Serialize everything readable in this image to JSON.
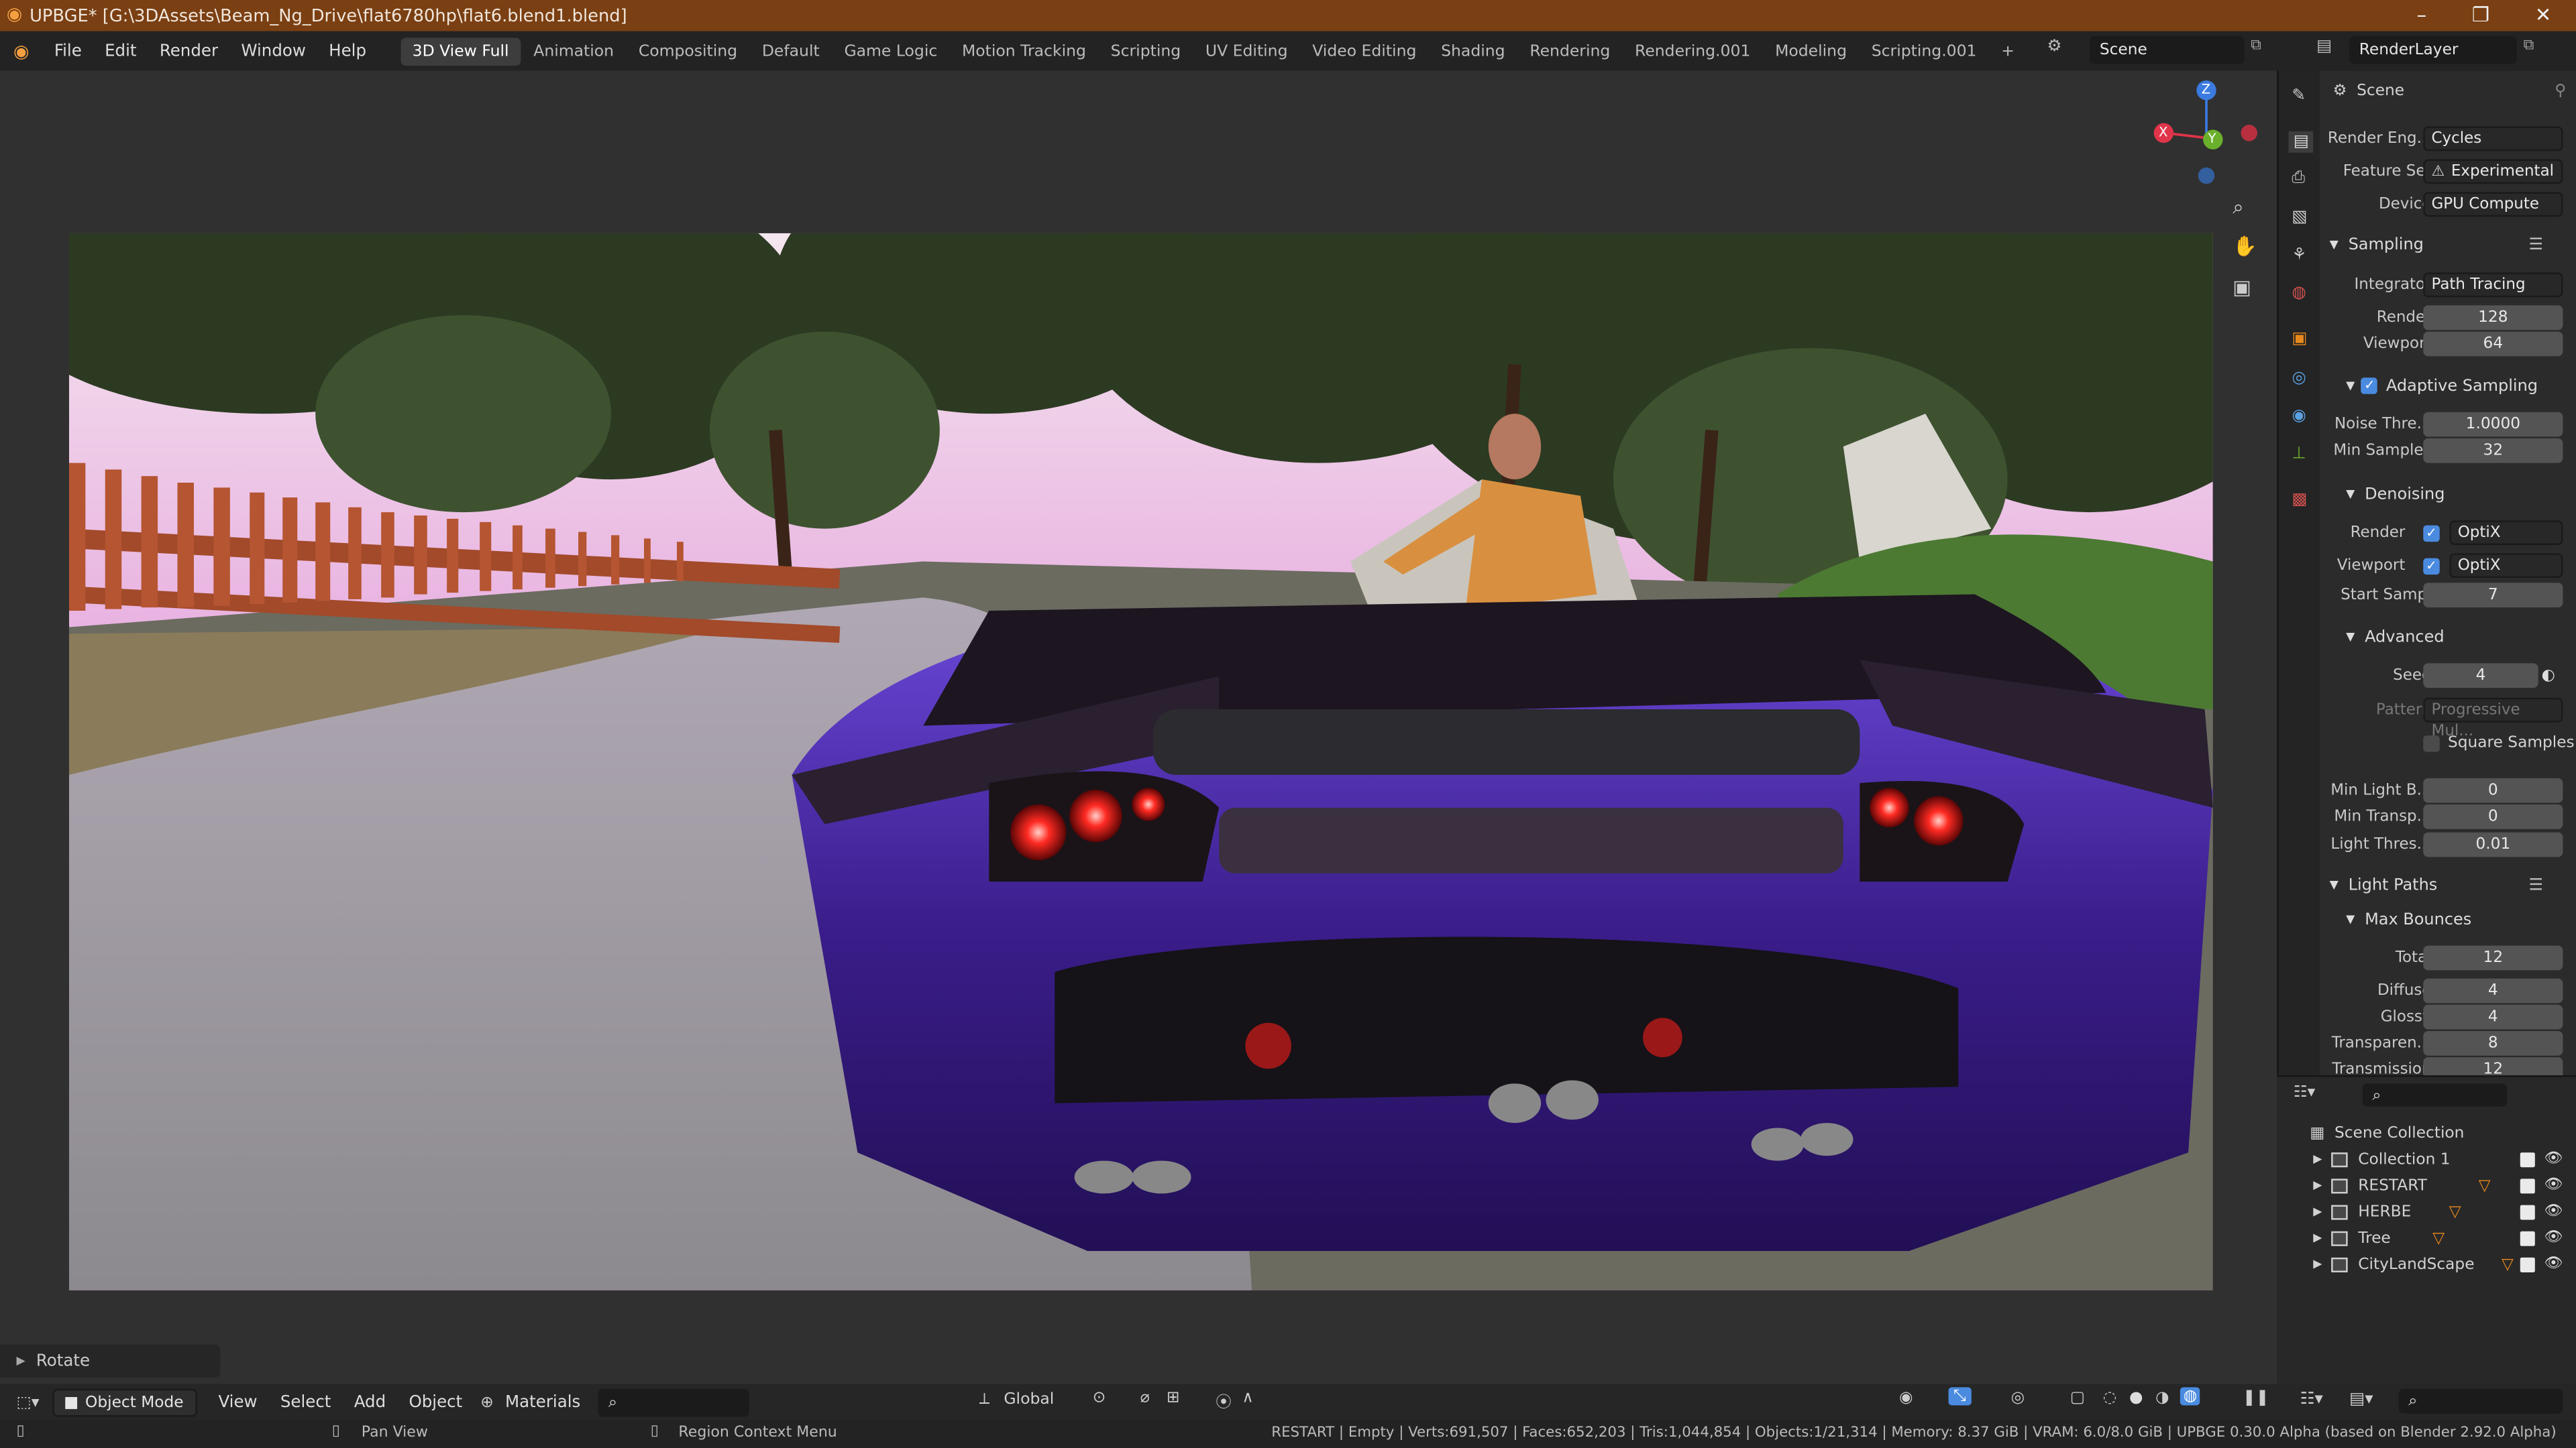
{
  "window": {
    "title": "UPBGE* [G:\\3DAssets\\Beam_Ng_Drive\\flat6780hp\\flat6.blend1.blend]",
    "minimize": "–",
    "maximize": "❐",
    "close": "✕"
  },
  "menu": [
    "File",
    "Edit",
    "Render",
    "Window",
    "Help"
  ],
  "workspaces": [
    "3D View Full",
    "Animation",
    "Compositing",
    "Default",
    "Game Logic",
    "Motion Tracking",
    "Scripting",
    "UV Editing",
    "Video Editing",
    "Shading",
    "Rendering",
    "Rendering.001",
    "Modeling",
    "Scripting.001"
  ],
  "workspace_add": "+",
  "scene": {
    "name": "Scene",
    "render_layer": "RenderLayer"
  },
  "viewport": {
    "gizmo": {
      "x": "X",
      "y": "Y",
      "z": "Z"
    },
    "last_operator": "Rotate"
  },
  "header": {
    "mode": "Object Mode",
    "menus": [
      "View",
      "Select",
      "Add",
      "Object"
    ],
    "materials": "Materials",
    "orientation": "Global"
  },
  "properties": {
    "title": "Scene",
    "render_engine_label": "Render Eng...",
    "render_engine": "Cycles",
    "feature_set_label": "Feature Set",
    "feature_set": "Experimental",
    "device_label": "Device",
    "device": "GPU Compute",
    "sampling": "Sampling",
    "integrator_label": "Integrator",
    "integrator": "Path Tracing",
    "render_label": "Render",
    "render_samples": "128",
    "viewport_label": "Viewport",
    "viewport_samples": "64",
    "adaptive": "Adaptive Sampling",
    "noise_label": "Noise Thre...",
    "noise": "1.0000",
    "min_samples_label": "Min Samples",
    "min_samples": "32",
    "denoising": "Denoising",
    "den_render_label": "Render",
    "den_render": "OptiX",
    "den_viewport_label": "Viewport",
    "den_viewport": "OptiX",
    "start_label": "Start Sampl",
    "start": "7",
    "advanced": "Advanced",
    "seed_label": "Seed",
    "seed": "4",
    "pattern_label": "Pattern",
    "pattern": "Progressive Mul...",
    "square": "Square Samples",
    "minlight_label": "Min Light B...",
    "minlight": "0",
    "mintransp_label": "Min Transp...",
    "mintransp": "0",
    "lightthres_label": "Light Thres...",
    "lightthres": "0.01",
    "lightpaths": "Light Paths",
    "maxbounces": "Max Bounces",
    "total_label": "Total",
    "total": "12",
    "diffuse_label": "Diffuse",
    "diffuse": "4",
    "glossy_label": "Glossy",
    "glossy": "4",
    "transparent_label": "Transparen...",
    "transparent": "8",
    "transmission_label": "Transmission",
    "transmission": "12"
  },
  "outliner": {
    "root": "Scene Collection",
    "items": [
      "Collection 1",
      "RESTART",
      "HERBE",
      "Tree",
      "CityLandScape"
    ]
  },
  "status": {
    "hint1": "Pan View",
    "hint2": "Region Context Menu",
    "stats": "RESTART | Empty | Verts:691,507 | Faces:652,203 | Tris:1,044,854 | Objects:1/21,314 | Memory: 8.37 GiB | VRAM: 6.0/8.0 GiB | UPBGE 0.30.0 Alpha (based on Blender 2.92.0 Alpha)"
  },
  "colors": {
    "accent": "#4a8be0",
    "titlebar": "#7a3f12",
    "car": "#3a1d8a"
  }
}
